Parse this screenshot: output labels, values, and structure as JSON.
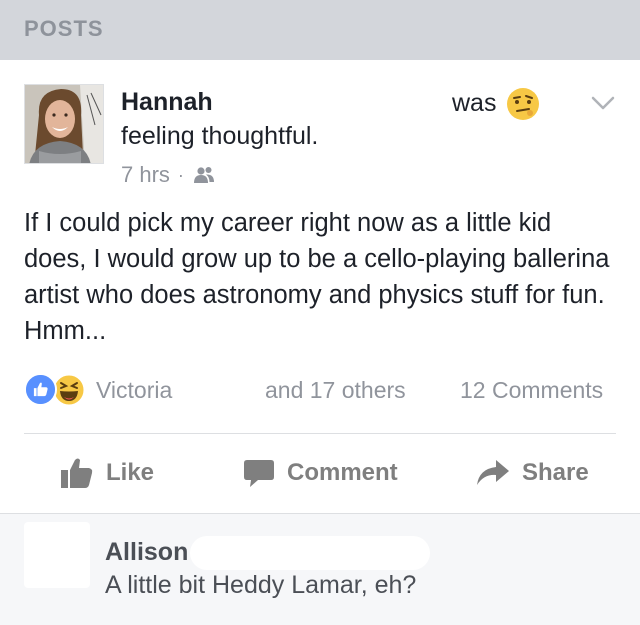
{
  "section": {
    "title": "POSTS"
  },
  "post": {
    "author": "Hannah",
    "was_label": "was",
    "feeling": "feeling thoughtful.",
    "time": "7 hrs",
    "dot": "·",
    "privacy_icon": "friends-icon",
    "feeling_icon": "thoughtful-emoji-icon",
    "text": "If I could pick my career right now as a little kid does, I would grow up to be a cello-playing ballerina artist who does astronomy and physics stuff for fun.  Hmm..."
  },
  "reactions": {
    "icons": [
      "like-icon",
      "haha-icon"
    ],
    "name": "Victoria",
    "others": "and 17 others",
    "comments": "12 Comments"
  },
  "actions": {
    "like": "Like",
    "comment": "Comment",
    "share": "Share"
  },
  "comment": {
    "author": "Allison",
    "text": "A little bit Heddy Lamar, eh?"
  },
  "colors": {
    "header_bg": "#d3d6db",
    "header_text": "#8e939b",
    "like_blue": "#5890ff",
    "meta_gray": "#90949c",
    "action_gray": "#7f7f7f",
    "emoji_yellow": "#f7c845"
  }
}
